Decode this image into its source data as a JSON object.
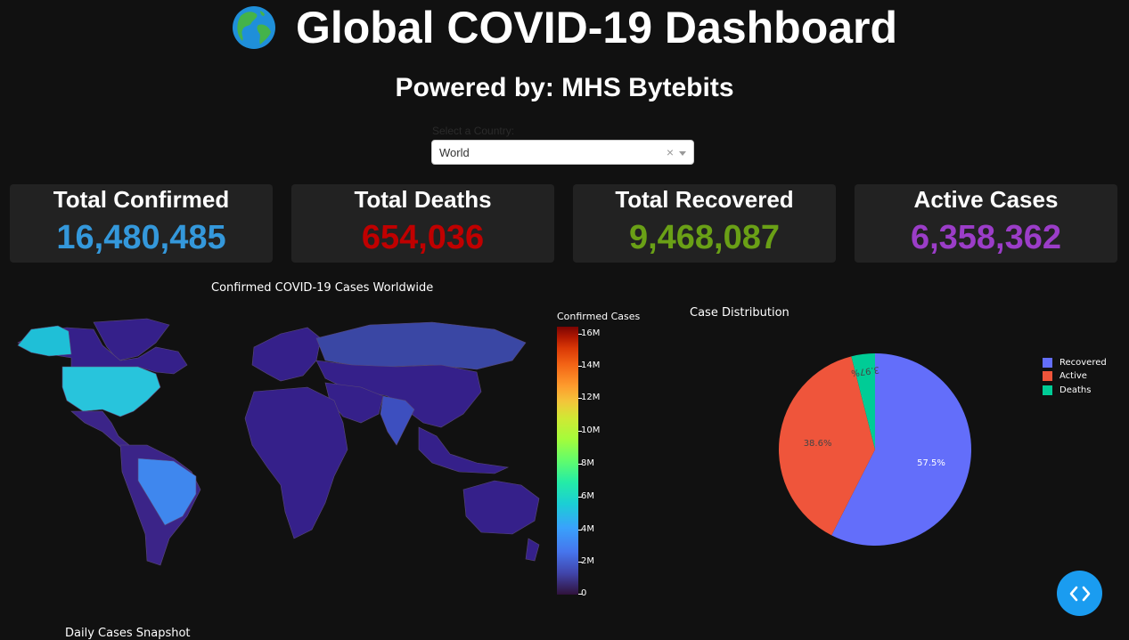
{
  "header": {
    "title": "Global COVID-19 Dashboard",
    "globe_icon": "globe-icon",
    "subtitle": "Powered by: MHS Bytebits"
  },
  "country_select": {
    "label": "Select a Country:",
    "value": "World",
    "clear_symbol": "×"
  },
  "stats": [
    {
      "label": "Total Confirmed",
      "value": "16,480,485",
      "color": "#3498db"
    },
    {
      "label": "Total Deaths",
      "value": "654,036",
      "color": "#c00000"
    },
    {
      "label": "Total Recovered",
      "value": "9,468,087",
      "color": "#6aa016"
    },
    {
      "label": "Active Cases",
      "value": "6,358,362",
      "color": "#9b3dc8"
    }
  ],
  "map": {
    "title": "Confirmed COVID-19 Cases Worldwide",
    "colorbar_title": "Confirmed Cases",
    "colorbar_ticks": [
      "16M",
      "14M",
      "12M",
      "10M",
      "8M",
      "6M",
      "4M",
      "2M",
      "0"
    ]
  },
  "pie": {
    "title": "Case Distribution",
    "legend": [
      {
        "label": "Recovered",
        "color": "#636efa"
      },
      {
        "label": "Active",
        "color": "#ef553b"
      },
      {
        "label": "Deaths",
        "color": "#00cc96"
      }
    ],
    "labels": [
      "57.5%",
      "38.6%",
      "3.97%"
    ]
  },
  "chart_data": {
    "type": "pie",
    "title": "Case Distribution",
    "categories": [
      "Recovered",
      "Active",
      "Deaths"
    ],
    "values": [
      57.5,
      38.6,
      3.97
    ],
    "legend": "top-right"
  },
  "bottom": {
    "section_title": "Daily Cases Snapshot"
  },
  "code_button": {
    "icon": "code-icon"
  }
}
